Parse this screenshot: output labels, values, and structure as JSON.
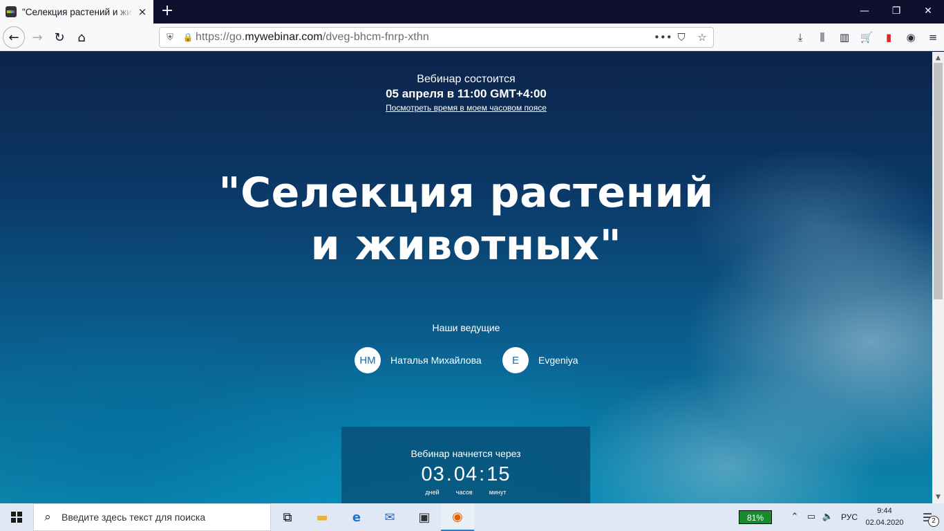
{
  "browser": {
    "tab": {
      "title": "\"Селекция растений и животных\"",
      "close_icon": "×"
    },
    "new_tab_icon": "+",
    "window_controls": {
      "minimize": "—",
      "maximize": "❐",
      "close": "✕"
    },
    "nav": {
      "back": "←",
      "forward": "→",
      "reload": "↻",
      "home": "⌂"
    },
    "url": {
      "prefix": "https://go.",
      "domain": "mywebinar.com",
      "path": "/dveg-bhcm-fnrp-xthn"
    },
    "url_actions": {
      "more": "•••",
      "pocket": "⛉",
      "bookmark": "☆"
    },
    "toolbar_icons": {
      "downloads": "⤓",
      "library": "⫼",
      "sidebar": "▥",
      "cart": "🛒",
      "flag": "▮",
      "account": "◉",
      "menu": "≡"
    }
  },
  "page": {
    "schedule": {
      "line1": "Вебинар состоится",
      "line2": "05 апреля в 11:00 GMT+4:00",
      "link": "Посмотреть время в моем часовом поясе"
    },
    "title_line1": "\"Селекция растений",
    "title_line2": "и животных\"",
    "hosts_title": "Наши ведущие",
    "hosts": [
      {
        "initials": "НМ",
        "name": "Наталья Михайлова"
      },
      {
        "initials": "E",
        "name": "Evgeniya"
      }
    ],
    "countdown": {
      "label": "Вебинар начнется через",
      "days": "03",
      "hours": "04",
      "minutes": "15",
      "sep1": ".",
      "sep2": ":",
      "unit_days": "дней",
      "unit_hours": "часов",
      "unit_minutes": "минут"
    }
  },
  "taskbar": {
    "search_placeholder": "Введите здесь текст для поиска",
    "battery": "81%",
    "language": "РУС",
    "time": "9:44",
    "date": "02.04.2020",
    "notifications_count": "2"
  }
}
